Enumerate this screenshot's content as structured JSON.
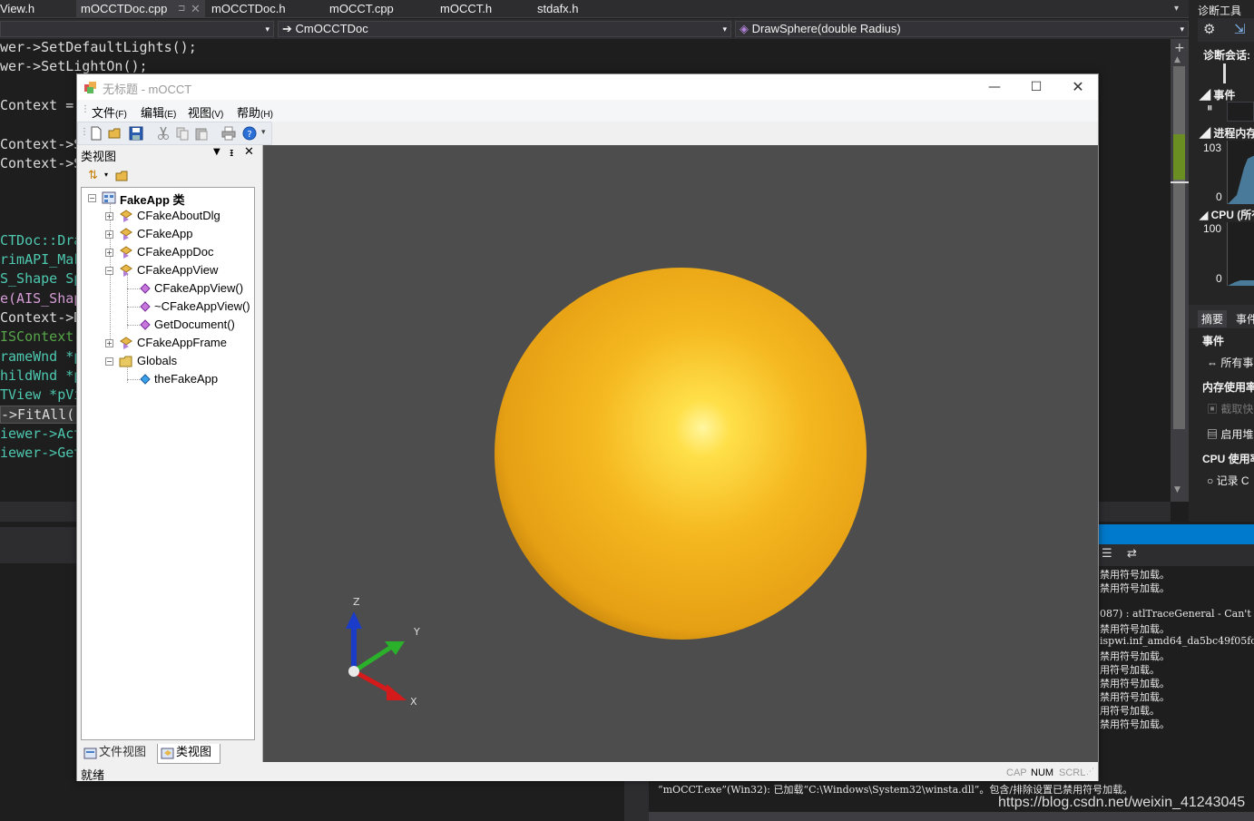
{
  "ide": {
    "tabs": [
      "View.h",
      "mOCCTDoc.cpp",
      "mOCCTDoc.h",
      "mOCCT.cpp",
      "mOCCT.h",
      "stdafx.h"
    ],
    "nav_member": "CmOCCTDoc",
    "nav_arrow": "➔",
    "nav_function": "DrawSphere(double Radius)",
    "code_lines": [
      "wer->SetDefaultLights();",
      "wer->SetLightOn();",
      "Context =",
      "Context->S",
      "Context->S",
      "CTDoc::Dra",
      "rimAPI_Mak",
      "S_Shape Sp",
      "e(AIS_Shap",
      "Context->D",
      "ISContext-",
      "rameWnd *p",
      "hildWnd *p",
      "TView *pVi",
      "->FitAll()",
      "iewer->Act",
      "iewer->Get"
    ],
    "diag_panel": {
      "title": "诊断工具",
      "session": "诊断会话:",
      "events": "事件",
      "process_memory": "进程内存",
      "mem_max": "103",
      "mem_min": "0",
      "cpu": "CPU (所有",
      "cpu_max": "100",
      "cpu_min": "0",
      "tab_summary": "摘要",
      "tab_events": "事件",
      "events_section": "事件",
      "all_events": "所有事",
      "memory_usage": "内存使用率",
      "snapshot": "截取快",
      "enable_heap": "启用堆",
      "cpu_usage": "CPU 使用率",
      "record": "记录 C"
    },
    "output_lines": [
      "禁用符号加载。",
      "禁用符号加载。",
      "",
      "087) : atlTraceGeneral - Can't",
      "禁用符号加载。",
      "ispwi.inf_amd64_da5bc49f05fc5",
      "禁用符号加载。",
      "用符号加载。",
      "禁用符号加载。",
      "禁用符号加载。",
      "用符号加载。",
      "禁用符号加载。"
    ],
    "output_last": "“mOCCT.exe”(Win32): 已加载“C:\\Windows\\System32\\winsta.dll”。包含/排除设置已禁用符号加载。",
    "watermark": "https://blog.csdn.net/weixin_41243045"
  },
  "app": {
    "title": "无标题 - mOCCT",
    "menu": [
      {
        "label": "文件",
        "key": "(F)"
      },
      {
        "label": "编辑",
        "key": "(E)"
      },
      {
        "label": "视图",
        "key": "(V)"
      },
      {
        "label": "帮助",
        "key": "(H)"
      }
    ],
    "class_view": {
      "title": "类视图",
      "root": "FakeApp 类",
      "items": [
        "CFakeAboutDlg",
        "CFakeApp",
        "CFakeAppDoc",
        "CFakeAppView",
        "CFakeAppView()",
        "~CFakeAppView()",
        "GetDocument()",
        "CFakeAppFrame",
        "Globals",
        "theFakeApp"
      ],
      "tab_file": "文件视图",
      "tab_class": "类视图"
    },
    "axes": {
      "z": "Z",
      "y": "Y",
      "x": "X"
    },
    "status": {
      "text": "就绪",
      "cap": "CAP",
      "num": "NUM",
      "scrl": "SCRL"
    },
    "colors": {
      "viewport_bg": "#4d4d4d",
      "sphere": "#f2b01e",
      "sphere_highlight": "#fff07a"
    }
  }
}
